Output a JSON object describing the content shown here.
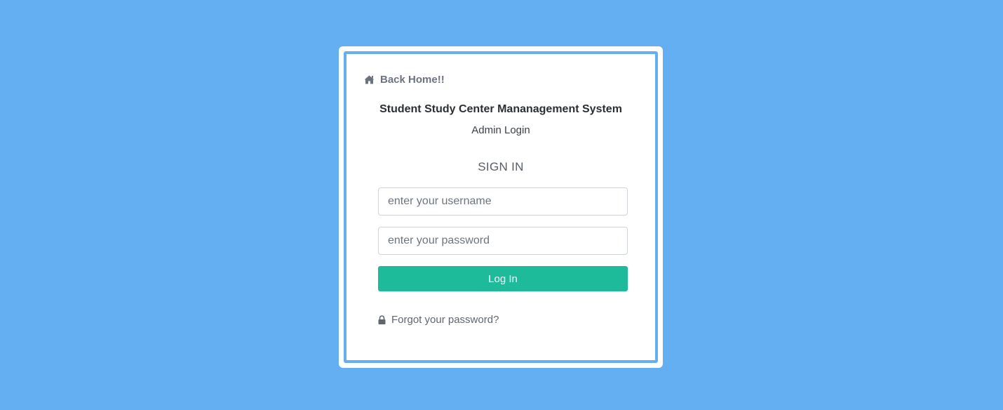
{
  "colors": {
    "background": "#64aff2",
    "card": "#ffffff",
    "accent_border": "#64aff2",
    "login_button": "#1dbb99"
  },
  "nav": {
    "back_home_label": "Back Home!!",
    "back_home_icon": "home-icon"
  },
  "header": {
    "system_title": "Student Study Center Mananagement System",
    "subtitle": "Admin Login"
  },
  "form": {
    "heading": "SIGN IN",
    "username": {
      "placeholder": "enter your username",
      "value": ""
    },
    "password": {
      "placeholder": "enter your password",
      "value": ""
    },
    "submit_label": "Log In",
    "forgot_label": "Forgot your password?",
    "forgot_icon": "lock-icon"
  }
}
